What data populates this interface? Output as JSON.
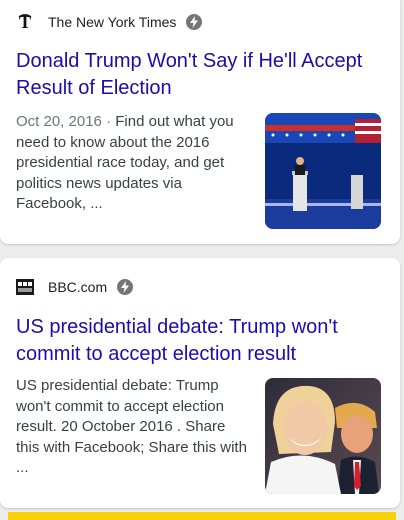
{
  "results": [
    {
      "source": "The New York Times",
      "favicon_icon": "nyt-logo-icon",
      "title": "Donald Trump Won't Say if He'll Accept Result of Election",
      "date": "Oct 20, 2016",
      "separator": " · ",
      "snippet": "Find out what you need to know about the 2016 presidential race today, and get politics news updates via Facebook, ..."
    },
    {
      "source": "BBC.com",
      "favicon_icon": "bbc-news-logo-icon",
      "title": "US presidential debate: Trump won't commit to accept election result",
      "snippet": "US presidential debate: Trump won't commit to accept election result. 20 October 2016 . Share this with Facebook; Share this with ..."
    }
  ],
  "amp_icon": "amp-lightning-icon",
  "colors": {
    "title_link": "#1a0dab",
    "snippet_text": "#3c4043",
    "date_text": "#70757a",
    "bottom_bar": "#f9d10a"
  }
}
